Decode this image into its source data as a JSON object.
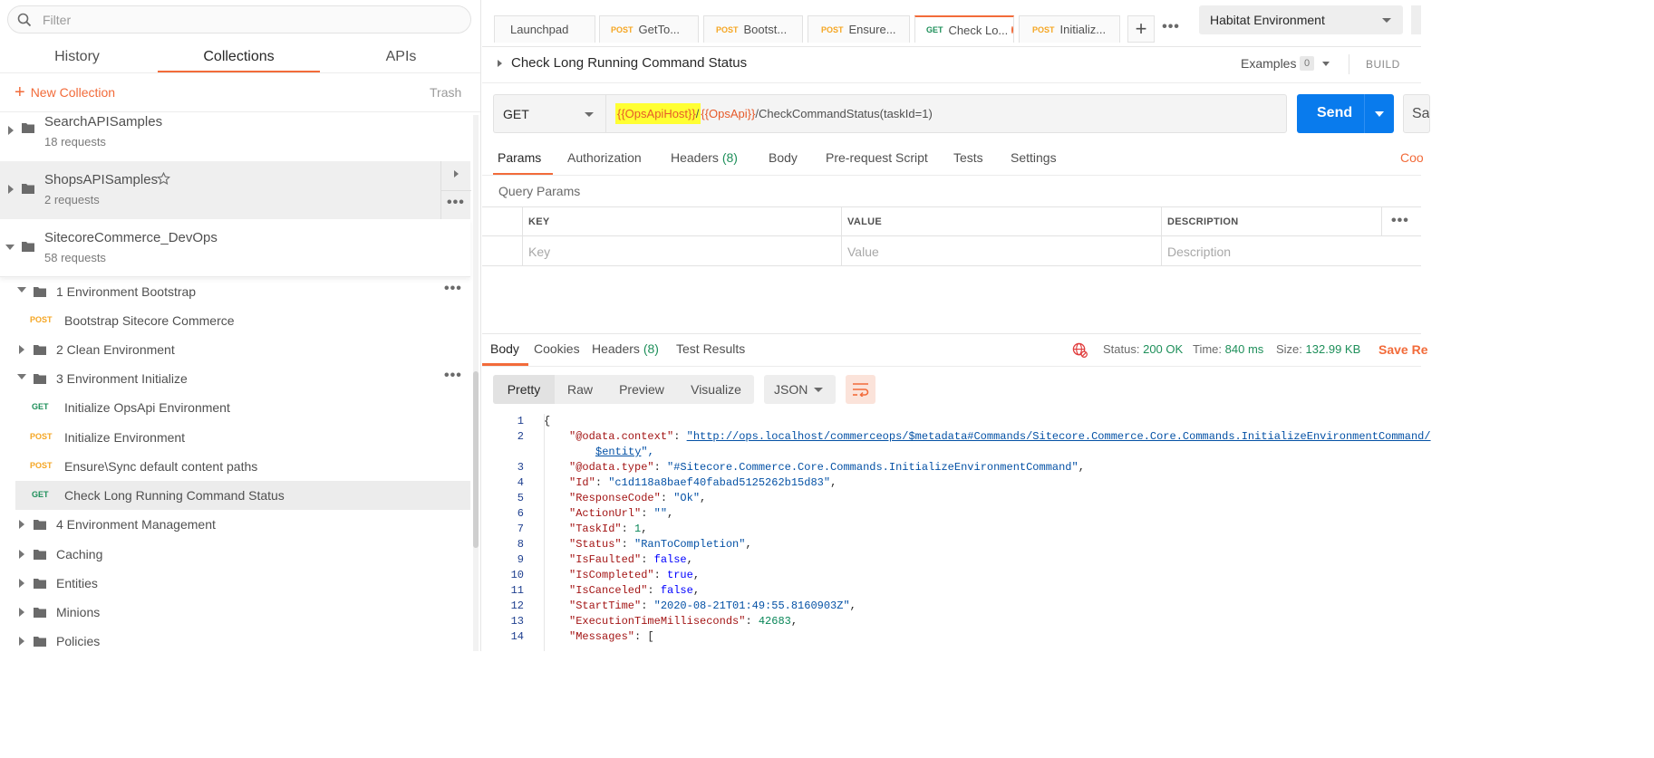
{
  "sidebar": {
    "filter_placeholder": "Filter",
    "tabs": {
      "history": "History",
      "collections": "Collections",
      "apis": "APIs"
    },
    "new_collection": "New Collection",
    "trash": "Trash",
    "collections": [
      {
        "name": "SearchAPISamples",
        "count": "18 requests"
      },
      {
        "name": "ShopsAPISamples",
        "count": "2 requests"
      },
      {
        "name": "SitecoreCommerce_DevOps",
        "count": "58 requests"
      }
    ],
    "tree": {
      "env_bootstrap": "1 Environment Bootstrap",
      "bootstrap_req": {
        "method": "POST",
        "label": "Bootstrap Sitecore Commerce"
      },
      "clean_env": "2 Clean Environment",
      "env_initialize": "3 Environment Initialize",
      "init_opsapi": {
        "method": "GET",
        "label": "Initialize OpsApi Environment"
      },
      "init_env": {
        "method": "POST",
        "label": "Initialize Environment"
      },
      "ensure_sync": {
        "method": "POST",
        "label": "Ensure\\Sync default content paths"
      },
      "check_status": {
        "method": "GET",
        "label": "Check Long Running Command Status"
      },
      "env_mgmt": "4 Environment Management",
      "caching": "Caching",
      "entities": "Entities",
      "minions": "Minions",
      "policies": "Policies"
    }
  },
  "tabs": [
    {
      "method": "",
      "label": "Launchpad"
    },
    {
      "method": "POST",
      "label": "GetTo..."
    },
    {
      "method": "POST",
      "label": "Bootst..."
    },
    {
      "method": "POST",
      "label": "Ensure..."
    },
    {
      "method": "GET",
      "label": "Check Lo..."
    },
    {
      "method": "POST",
      "label": "Initializ..."
    }
  ],
  "tab_add": "+",
  "environment": "Habitat Environment",
  "request": {
    "title": "Check Long Running Command Status",
    "examples_label": "Examples",
    "examples_count": "0",
    "build": "BUILD",
    "method": "GET",
    "url": {
      "host_var": "{{OpsApiHost}}",
      "slash": "/",
      "api_var": "{{OpsApi}}",
      "path": "/CheckCommandStatus(taskId=1)"
    },
    "send": "Send",
    "save": "Sa"
  },
  "request_tabs": {
    "params": "Params",
    "authorization": "Authorization",
    "headers": "Headers",
    "headers_count": "(8)",
    "body": "Body",
    "prerequest": "Pre-request Script",
    "tests": "Tests",
    "settings": "Settings",
    "cookies": "Coo"
  },
  "query_params": {
    "title": "Query Params",
    "headers": {
      "key": "KEY",
      "value": "VALUE",
      "description": "DESCRIPTION"
    },
    "placeholders": {
      "key": "Key",
      "value": "Value",
      "description": "Description"
    }
  },
  "response": {
    "tabs": {
      "body": "Body",
      "cookies": "Cookies",
      "headers": "Headers",
      "headers_count": "(8)",
      "tests": "Test Results"
    },
    "status_label": "Status:",
    "status": "200 OK",
    "time_label": "Time:",
    "time": "840 ms",
    "size_label": "Size:",
    "size": "132.99 KB",
    "save": "Save Re",
    "formats": {
      "pretty": "Pretty",
      "raw": "Raw",
      "preview": "Preview",
      "visualize": "Visualize"
    },
    "language": "JSON"
  },
  "code": {
    "l1": "{",
    "context_key": "\"@odata.context\"",
    "context_val": "\"http://ops.localhost/commerceops/$metadata#Commands/Sitecore.Commerce.Core.Commands.InitializeEnvironmentCommand/",
    "context_val2": "$entity",
    "type_key": "\"@odata.type\"",
    "type_val": "\"#Sitecore.Commerce.Core.Commands.InitializeEnvironmentCommand\"",
    "id_key": "\"Id\"",
    "id_val": "\"c1d118a8baef40fabad5125262b15d83\"",
    "rc_key": "\"ResponseCode\"",
    "rc_val": "\"Ok\"",
    "au_key": "\"ActionUrl\"",
    "au_val": "\"\"",
    "tid_key": "\"TaskId\"",
    "tid_val": "1",
    "st_key": "\"Status\"",
    "st_val": "\"RanToCompletion\"",
    "if_key": "\"IsFaulted\"",
    "if_val": "false",
    "ic_key": "\"IsCompleted\"",
    "ic_val": "true",
    "ica_key": "\"IsCanceled\"",
    "ica_val": "false",
    "sti_key": "\"StartTime\"",
    "sti_val": "\"2020-08-21T01:49:55.8160903Z\"",
    "et_key": "\"ExecutionTimeMilliseconds\"",
    "et_val": "42683",
    "msg_key": "\"Messages\"",
    "msg_val": "["
  },
  "colors": {
    "accent": "#f26b3a",
    "send": "#097bed",
    "post": "#f5a623",
    "get": "#1e8f5a",
    "highlight": "#ffff33"
  }
}
